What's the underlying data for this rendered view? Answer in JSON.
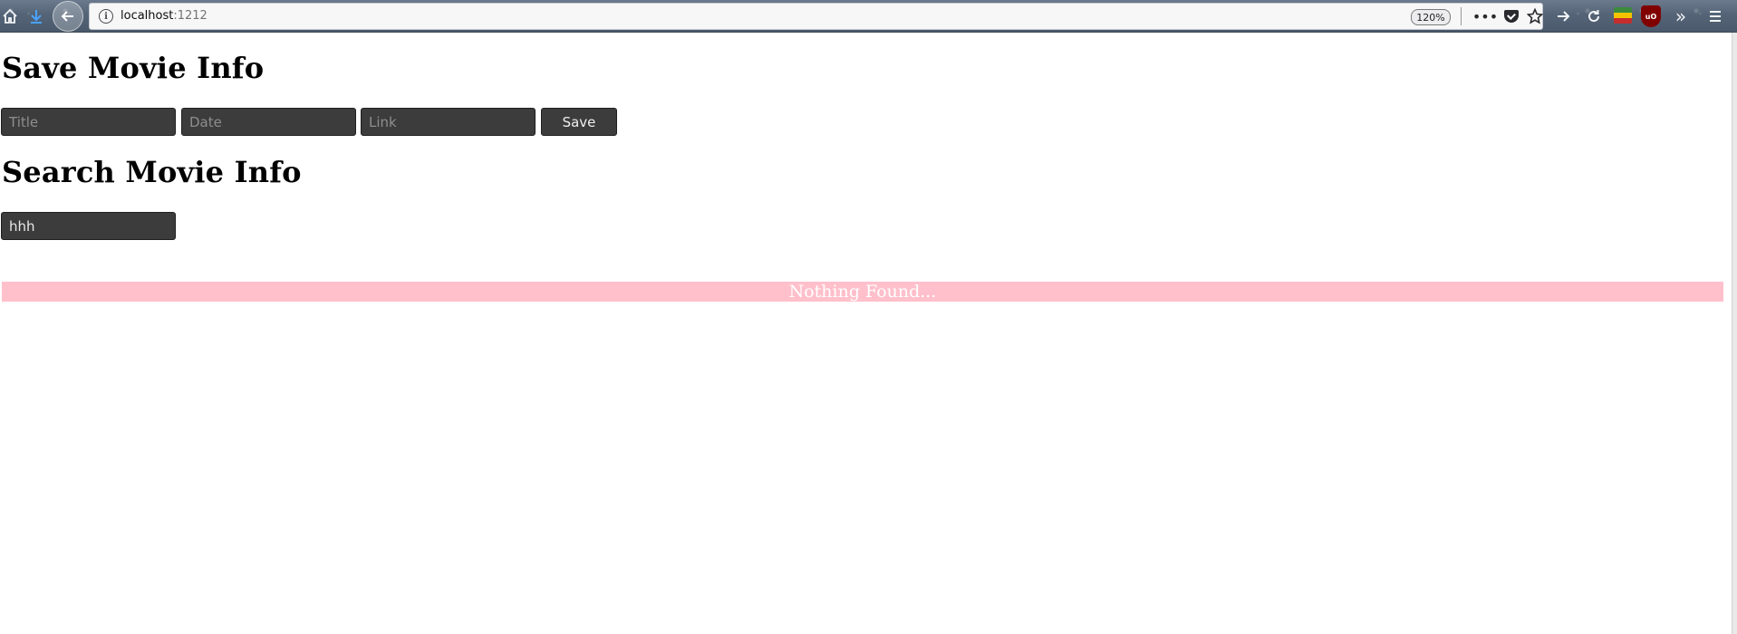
{
  "browser": {
    "url_host": "localhost",
    "url_port": ":1212",
    "zoom": "120%",
    "icons": [
      "home-icon",
      "download-icon",
      "back-icon",
      "info-icon",
      "more-icon",
      "pocket-icon",
      "bookmark-star-icon",
      "forward-icon",
      "reload-icon",
      "extension-flag-icon",
      "ublock-icon",
      "overflow-icon",
      "menu-icon"
    ],
    "ublock_label": "uO"
  },
  "save_section": {
    "heading": "Save Movie Info",
    "title_placeholder": "Title",
    "date_placeholder": "Date",
    "link_placeholder": "Link",
    "save_label": "Save"
  },
  "search_section": {
    "heading": "Search Movie Info",
    "search_value": "hhh"
  },
  "result": {
    "message": "Nothing Found...",
    "background": "#ffc0cb"
  }
}
